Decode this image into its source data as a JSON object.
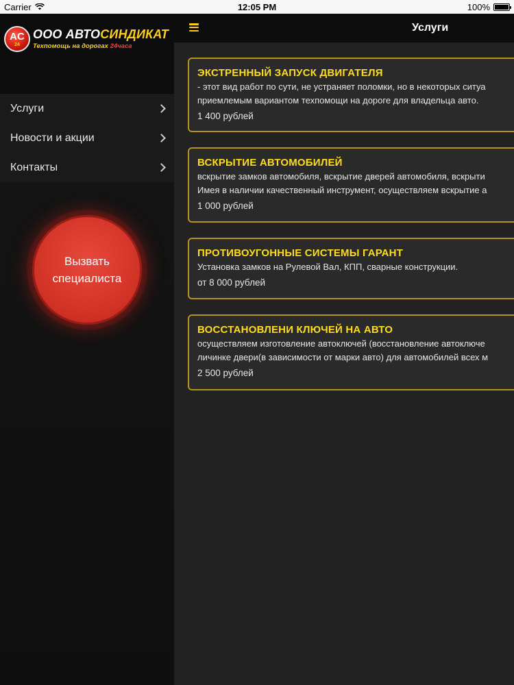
{
  "status_bar": {
    "carrier": "Carrier",
    "time": "12:05 PM",
    "battery": "100%",
    "wifi_icon": "wifi-icon",
    "battery_icon": "battery-icon"
  },
  "sidebar": {
    "logo": {
      "badge_text": "AC",
      "badge_small": "24",
      "title_prefix": "ООО АВТО",
      "title_suffix": "СИНДИКАТ",
      "subtitle": "Техпомощь на дорогах",
      "subtitle_suffix": "24часа"
    },
    "menu": [
      {
        "label": "Услуги"
      },
      {
        "label": "Новости и акции"
      },
      {
        "label": "Контакты"
      }
    ],
    "call_button": {
      "line1": "Вызвать",
      "line2": "специалиста"
    }
  },
  "header": {
    "title": "Услуги"
  },
  "services": [
    {
      "title": "ЭКСТРЕННЫЙ ЗАПУСК ДВИГАТЕЛЯ",
      "desc1": "- этот вид работ по сути, не устраняет поломки, но в некоторых ситуа",
      "desc2": "приемлемым вариантом техпомощи на дороге для владельца авто.",
      "price": "1 400 рублей"
    },
    {
      "title": "ВСКРЫТИЕ АВТОМОБИЛЕЙ",
      "desc1": "вскрытие замков автомобиля, вскрытие дверей автомобиля, вскрыти",
      "desc2": "Имея в наличии качественный инструмент, осуществляем вскрытие а",
      "price": "1 000 рублей"
    },
    {
      "title": "ПРОТИВОУГОННЫЕ СИСТЕМЫ ГАРАНТ",
      "desc1": "Установка замков на Рулевой Вал, КПП, сварные конструкции.",
      "price": "от 8 000 рублей"
    },
    {
      "title": "ВОССТАНОВЛЕНИ КЛЮЧЕЙ НА АВТО",
      "desc1": "осуществляем изготовление автоключей (восстановление автоключе",
      "desc2": "личинке двери(в зависимости от марки авто) для автомобилей всех м",
      "price": "2 500 рублей"
    }
  ]
}
